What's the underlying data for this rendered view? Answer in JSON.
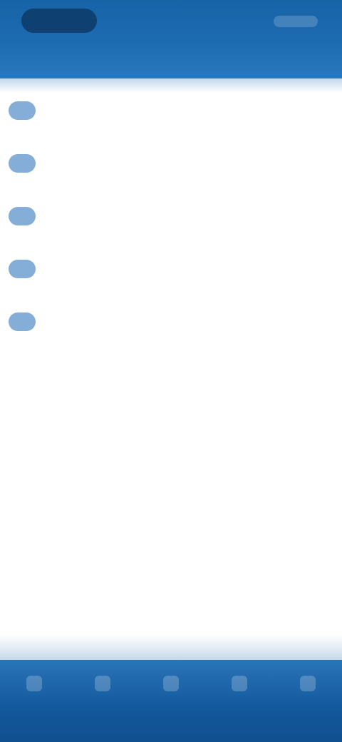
{
  "header": {
    "title": ""
  },
  "list": {
    "items": [
      {
        "label": ""
      },
      {
        "label": ""
      },
      {
        "label": ""
      },
      {
        "label": ""
      },
      {
        "label": ""
      }
    ]
  },
  "bottom_nav": {
    "items": [
      {
        "label": ""
      },
      {
        "label": ""
      },
      {
        "label": ""
      },
      {
        "label": ""
      },
      {
        "label": ""
      }
    ]
  },
  "colors": {
    "header": "#1e6cb2",
    "bottom_bar": "#145a9e",
    "item_icon": "#6f9fd0"
  }
}
